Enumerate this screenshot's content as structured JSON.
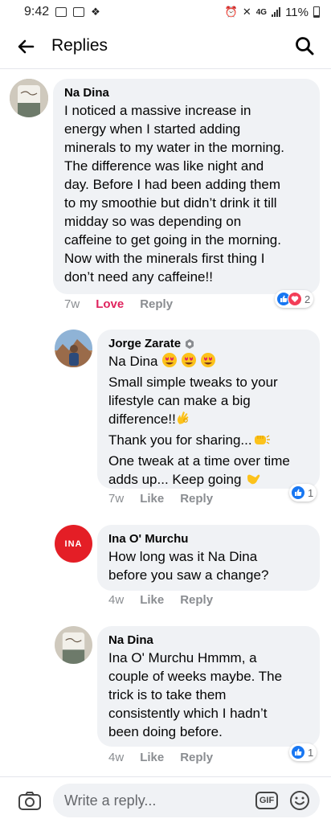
{
  "status": {
    "time": "9:42",
    "network": "4G",
    "battery": "11%"
  },
  "header": {
    "title": "Replies"
  },
  "comments": [
    {
      "author": "Na Dina",
      "text": "I noticed a massive increase in\nenergy when I started adding\nminerals to my water in the morning.\nThe difference was like night and\nday. Before I had been adding them\nto my smoothie but didn’t drink it till\nmidday so was depending on\ncaffeine to get going in the morning.\nNow with the minerals first thing I\ndon’t need any caffeine!!",
      "time": "7w",
      "love_label": "Love",
      "reply_label": "Reply",
      "reaction_count": "2"
    },
    {
      "author": "Jorge Zarate",
      "mention": "Na Dina",
      "line1": "Small simple tweaks to your",
      "line2": "lifestyle can make a big",
      "line3": "difference!!",
      "line4": "Thank you for sharing...",
      "line5": "One tweak at a time over time",
      "line6": "adds up... Keep going",
      "time": "7w",
      "like_label": "Like",
      "reply_label": "Reply",
      "reaction_count": "1"
    },
    {
      "author": "Ina O' Murchu",
      "avatar_text": "INA",
      "text": "How long was it Na Dina\nbefore you saw a change?",
      "time": "4w",
      "like_label": "Like",
      "reply_label": "Reply"
    },
    {
      "author": "Na Dina",
      "text": "Ina O' Murchu Hmmm, a\ncouple of weeks maybe. The\ntrick is to take them\nconsistently which I hadn’t\nbeen doing before.",
      "time": "4w",
      "like_label": "Like",
      "reply_label": "Reply",
      "reaction_count": "1"
    }
  ],
  "composer": {
    "placeholder": "Write a reply...",
    "gif_label": "GIF"
  },
  "colors": {
    "accent": "#1877f2",
    "love": "#e0245e",
    "bubble": "#f0f2f5",
    "ina_avatar": "#e41e26"
  }
}
